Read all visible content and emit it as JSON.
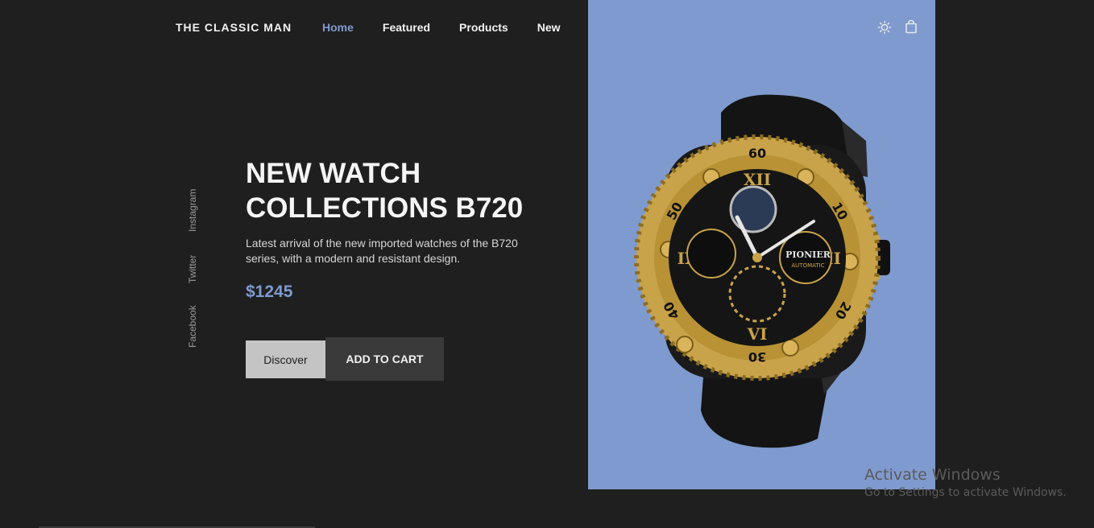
{
  "header": {
    "logo": "THE CLASSIC MAN",
    "nav": [
      {
        "label": "Home",
        "active": true
      },
      {
        "label": "Featured",
        "active": false
      },
      {
        "label": "Products",
        "active": false
      },
      {
        "label": "New",
        "active": false
      }
    ],
    "icons": [
      "sun-icon",
      "shopping-bag-icon"
    ]
  },
  "social": [
    "Instagram",
    "Twitter",
    "Facebook"
  ],
  "hero": {
    "title_line1": "NEW WATCH",
    "title_line2": "COLLECTIONS B720",
    "description": "Latest arrival of the new imported watches of the B720 series, with a modern and resistant design.",
    "price": "$1245",
    "discover_label": "Discover",
    "cart_label": "ADD TO CART",
    "watch_brand": "PIONIER",
    "watch_sub": "AUTOMATIC"
  },
  "colors": {
    "background": "#1f1f1f",
    "accent": "#7f9ace",
    "panel": "#7f9ace"
  },
  "watermark": {
    "title": "Activate Windows",
    "subtitle": "Go to Settings to activate Windows."
  }
}
